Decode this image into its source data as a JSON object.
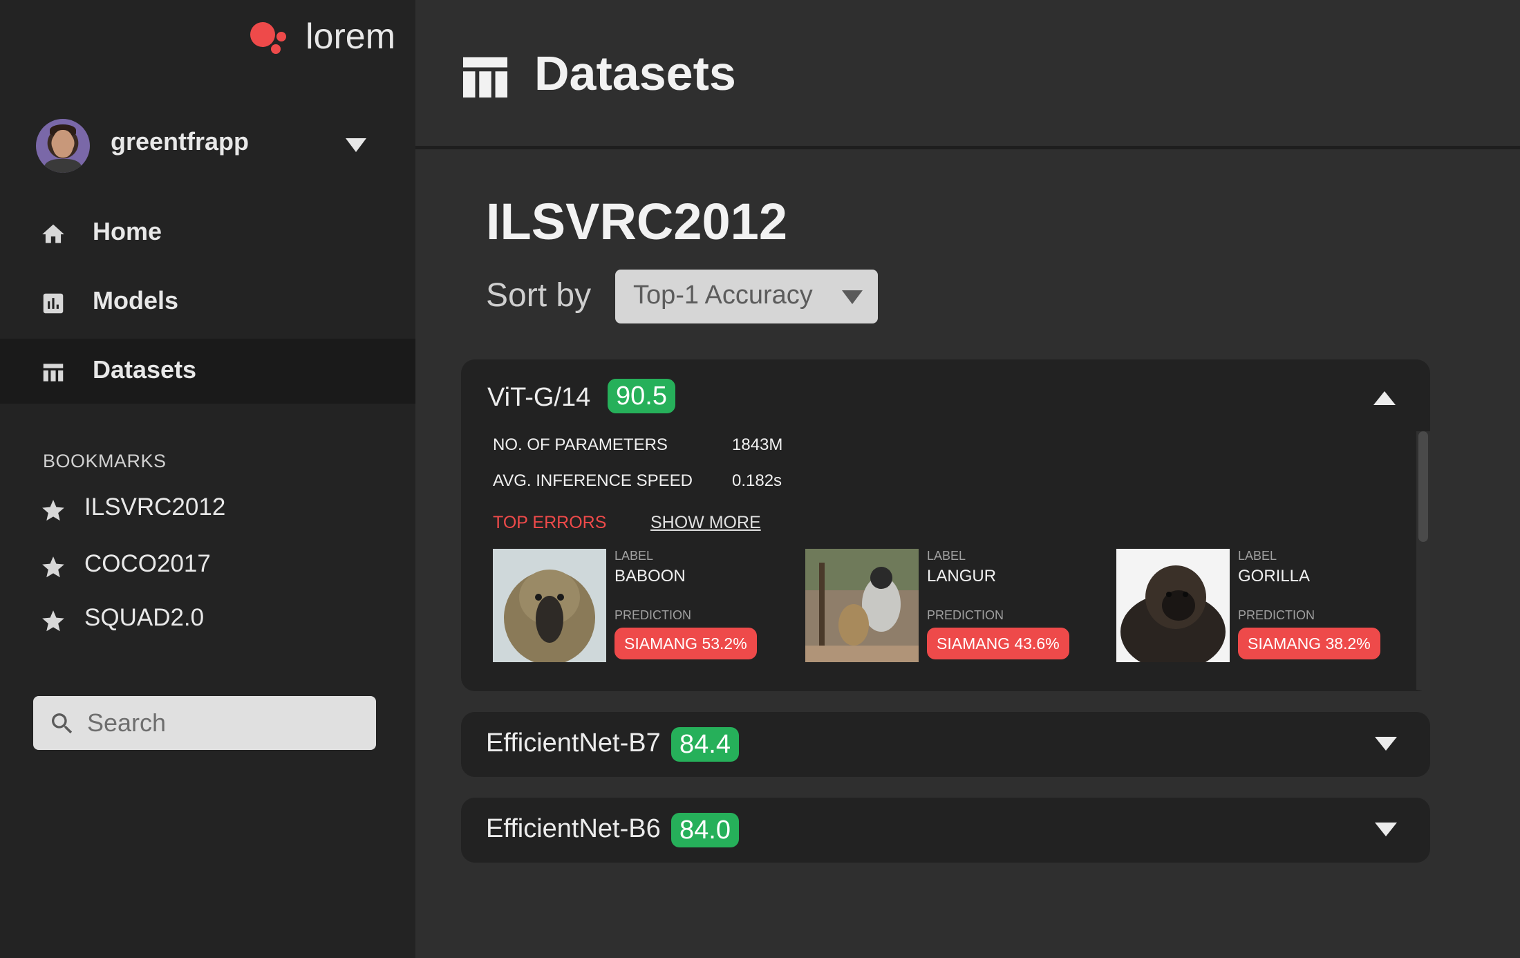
{
  "app": {
    "logo_text": "lorem"
  },
  "user": {
    "name": "greentfrapp"
  },
  "nav": {
    "items": [
      {
        "label": "Home",
        "icon": "home-icon"
      },
      {
        "label": "Models",
        "icon": "bar-chart-icon"
      },
      {
        "label": "Datasets",
        "icon": "table-icon",
        "active": true
      }
    ]
  },
  "bookmarks": {
    "title": "BOOKMARKS",
    "items": [
      {
        "label": "ILSVRC2012",
        "icon": "star-icon"
      },
      {
        "label": "COCO2017",
        "icon": "star-icon"
      },
      {
        "label": "SQUAD2.0",
        "icon": "star-icon"
      }
    ]
  },
  "search": {
    "placeholder": "Search"
  },
  "header": {
    "title": "Datasets",
    "icon": "table-icon"
  },
  "dataset": {
    "name": "ILSVRC2012",
    "sort_label": "Sort by",
    "sort_value": "Top-1 Accuracy"
  },
  "models": [
    {
      "name": "ViT-G/14",
      "score": "90.5",
      "expanded": true,
      "specs": [
        {
          "key": "NO. OF PARAMETERS",
          "value": "1843M"
        },
        {
          "key": "AVG. INFERENCE SPEED",
          "value": "0.182s"
        }
      ],
      "top_errors_label": "TOP ERRORS",
      "show_more_label": "SHOW MORE",
      "errors": [
        {
          "label_key": "LABEL",
          "label": "BABOON",
          "prediction_key": "PREDICTION",
          "prediction": "SIAMANG  53.2%"
        },
        {
          "label_key": "LABEL",
          "label": "LANGUR",
          "prediction_key": "PREDICTION",
          "prediction": "SIAMANG  43.6%"
        },
        {
          "label_key": "LABEL",
          "label": "GORILLA",
          "prediction_key": "PREDICTION",
          "prediction": "SIAMANG  38.2%"
        }
      ]
    },
    {
      "name": "EfficientNet-B7",
      "score": "84.4",
      "expanded": false
    },
    {
      "name": "EfficientNet-B6",
      "score": "84.0",
      "expanded": false
    }
  ],
  "colors": {
    "accent_red": "#ee4a4a",
    "badge_green": "#26b05a",
    "sidebar_bg": "#232323",
    "main_bg": "#2f2f2f",
    "card_bg": "#222222"
  }
}
